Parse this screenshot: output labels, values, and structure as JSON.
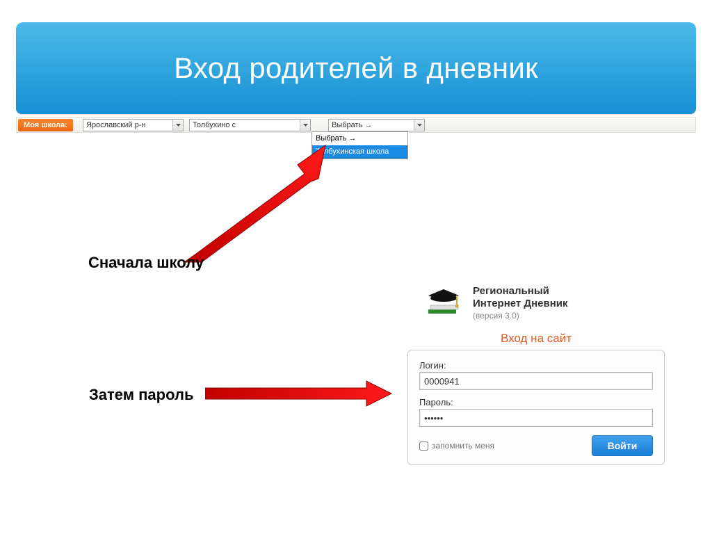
{
  "header": {
    "title": "Вход родителей в дневник"
  },
  "selbar": {
    "badge": "Моя школа:",
    "combo1": "Ярославский р-н",
    "combo2": "Толбухино с",
    "combo3": "Выбрать →",
    "dropdown": {
      "opt1": "Выбрать →",
      "opt2": "Толбухинская школа"
    }
  },
  "annot": {
    "school": "Сначала школу",
    "password": "Затем пароль"
  },
  "brand": {
    "line1": "Региональный",
    "line2": "Интернет Дневник",
    "version": "(версия 3.0)"
  },
  "login": {
    "title": "Вход на сайт",
    "login_label": "Логин:",
    "login_value": "0000941",
    "password_label": "Пароль:",
    "password_value": "••••••",
    "remember_label": "запомнить меня",
    "submit": "Войти"
  }
}
